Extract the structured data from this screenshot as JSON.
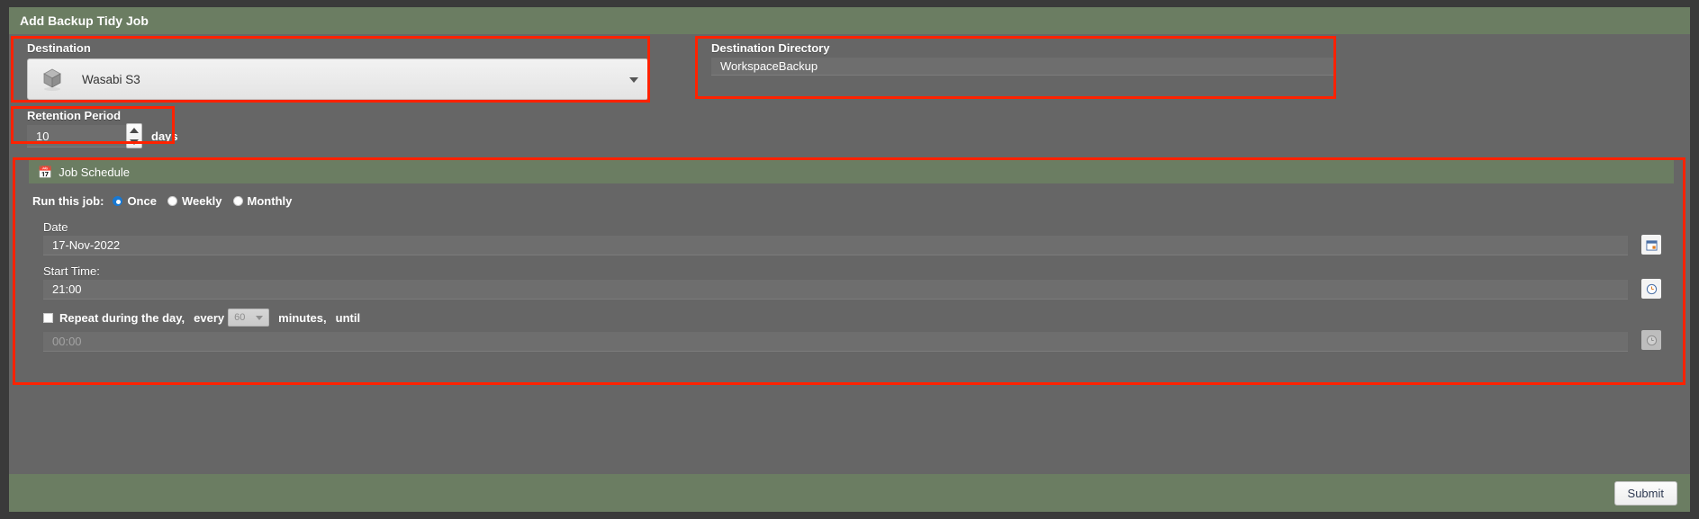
{
  "window": {
    "title": "Add Backup Tidy Job"
  },
  "destination": {
    "label": "Destination",
    "selected": "Wasabi S3",
    "icon": "cube-icon",
    "caret_icon": "chevron-down-icon"
  },
  "destination_directory": {
    "label": "Destination Directory",
    "value": "WorkspaceBackup",
    "placeholder": ""
  },
  "retention": {
    "label": "Retention Period",
    "value": "10",
    "unit": "days",
    "up_icon": "triangle-up-icon",
    "down_icon": "triangle-down-icon"
  },
  "schedule": {
    "header": "Job Schedule",
    "header_icon": "calendar-icon",
    "run_label": "Run this job:",
    "frequency_options": [
      {
        "label": "Once",
        "selected": true
      },
      {
        "label": "Weekly",
        "selected": false
      },
      {
        "label": "Monthly",
        "selected": false
      }
    ],
    "date": {
      "label": "Date",
      "value": "17-Nov-2022",
      "picker_icon": "calendar-icon"
    },
    "start_time": {
      "label": "Start Time:",
      "value": "21:00",
      "picker_icon": "clock-icon"
    },
    "repeat": {
      "checkbox_label": "Repeat during the day,",
      "checked": false,
      "every_label": "every",
      "interval_value": "60",
      "interval_caret_icon": "chevron-down-icon",
      "minutes_label": "minutes,",
      "until_label": "until",
      "until_value": "00:00",
      "until_picker_icon": "clock-icon"
    }
  },
  "footer": {
    "submit_label": "Submit"
  }
}
